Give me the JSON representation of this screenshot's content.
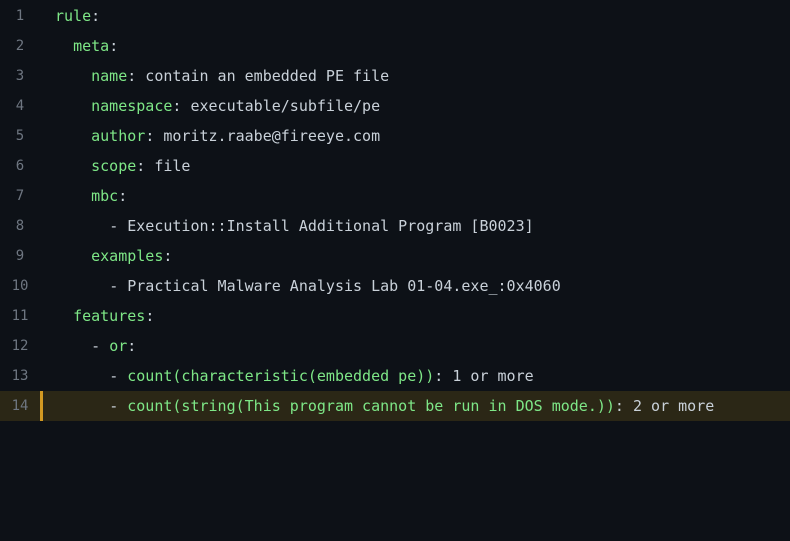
{
  "editor": {
    "lines": [
      {
        "num": "1",
        "indent": "",
        "dash": "",
        "key": "rule",
        "colon": ":",
        "value": ""
      },
      {
        "num": "2",
        "indent": "  ",
        "dash": "",
        "key": "meta",
        "colon": ":",
        "value": ""
      },
      {
        "num": "3",
        "indent": "    ",
        "dash": "",
        "key": "name",
        "colon": ":",
        "value": " contain an embedded PE file"
      },
      {
        "num": "4",
        "indent": "    ",
        "dash": "",
        "key": "namespace",
        "colon": ":",
        "value": " executable/subfile/pe"
      },
      {
        "num": "5",
        "indent": "    ",
        "dash": "",
        "key": "author",
        "colon": ":",
        "value": " moritz.raabe@fireeye.com"
      },
      {
        "num": "6",
        "indent": "    ",
        "dash": "",
        "key": "scope",
        "colon": ":",
        "value": " file"
      },
      {
        "num": "7",
        "indent": "    ",
        "dash": "",
        "key": "mbc",
        "colon": ":",
        "value": ""
      },
      {
        "num": "8",
        "indent": "      ",
        "dash": "- ",
        "key": "",
        "colon": "",
        "value": "Execution::Install Additional Program [B0023]"
      },
      {
        "num": "9",
        "indent": "    ",
        "dash": "",
        "key": "examples",
        "colon": ":",
        "value": ""
      },
      {
        "num": "10",
        "indent": "      ",
        "dash": "- ",
        "key": "",
        "colon": "",
        "value": "Practical Malware Analysis Lab 01-04.exe_:0x4060"
      },
      {
        "num": "11",
        "indent": "  ",
        "dash": "",
        "key": "features",
        "colon": ":",
        "value": ""
      },
      {
        "num": "12",
        "indent": "    ",
        "dash": "- ",
        "key": "or",
        "colon": ":",
        "value": ""
      },
      {
        "num": "13",
        "indent": "      ",
        "dash": "- ",
        "key": "count(characteristic(embedded pe))",
        "colon": ":",
        "value": " 1 or more"
      },
      {
        "num": "14",
        "indent": "      ",
        "dash": "- ",
        "key": "count(string(This program cannot be run in DOS mode.))",
        "colon": ":",
        "value": " 2 or more"
      }
    ],
    "highlighted_line": "14"
  },
  "colors": {
    "background": "#0d1117",
    "key": "#7ee787",
    "text": "#c9d1d9",
    "gutter": "#6e7681",
    "highlight": "#2b2716",
    "highlight_bar": "#d29922"
  }
}
